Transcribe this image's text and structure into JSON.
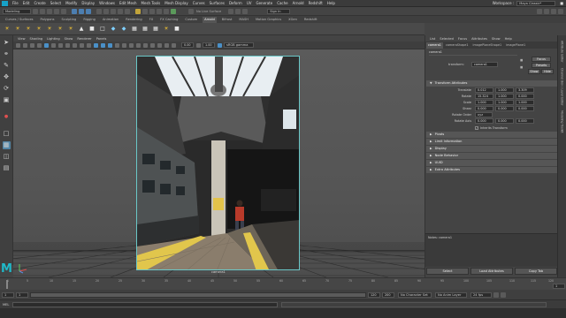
{
  "menubar": {
    "items": [
      "File",
      "Edit",
      "Create",
      "Select",
      "Modify",
      "Display",
      "Windows",
      "Edit Mesh",
      "Mesh Tools",
      "Mesh Display",
      "Curves",
      "Surfaces",
      "Deform",
      "UV",
      "Generate",
      "Cache",
      "Arnold",
      "Redshift",
      "Help"
    ],
    "workspace_label": "Workspace :",
    "workspace_value": "Maya Classic*"
  },
  "statusline": {
    "mode": "Modeling",
    "live_surface": "No Live Surface",
    "sign_in": "Sign In"
  },
  "shelf": {
    "tabs": [
      "Curves / Surfaces",
      "Polygons",
      "Sculpting",
      "Rigging",
      "Animation",
      "Rendering",
      "FX",
      "FX Caching",
      "Custom",
      "Arnold",
      "Bifrost",
      "MASH",
      "Motion Graphics",
      "XGen",
      "Redshift"
    ],
    "active_tab": "Arnold"
  },
  "viewport": {
    "menu": [
      "View",
      "Shading",
      "Lighting",
      "Show",
      "Renderer",
      "Panels"
    ],
    "exposure": "0.00",
    "gamma": "1.00",
    "color_space": "sRGB gamma",
    "camera_label": "camera1"
  },
  "attribute_editor": {
    "menu": [
      "List",
      "Selected",
      "Focus",
      "Attributes",
      "Show",
      "Help"
    ],
    "tabs": [
      "camera1",
      "cameraShape1",
      "imagePlaneShape1",
      "imagePlane1"
    ],
    "node_field": "camera1",
    "transform_label": "transform:",
    "transform_value": "camera1",
    "buttons_right": [
      "Focus",
      "Presets",
      "Show",
      "Hide"
    ],
    "sections": {
      "transform_attributes": "Transform Attributes",
      "collapsed": [
        "Pivots",
        "Limit Information",
        "Display",
        "Node Behavior",
        "UUID",
        "Extra Attributes"
      ]
    },
    "attrs": [
      {
        "label": "Translate",
        "values": [
          "0.012",
          "1.000",
          "3.309"
        ]
      },
      {
        "label": "Rotate",
        "values": [
          "15.324",
          "1.000",
          "0.000"
        ]
      },
      {
        "label": "Scale",
        "values": [
          "1.000",
          "1.000",
          "1.000"
        ]
      },
      {
        "label": "Shear",
        "values": [
          "0.000",
          "0.000",
          "0.000"
        ]
      },
      {
        "label": "Rotate Order",
        "values": [
          "xyz"
        ]
      },
      {
        "label": "Rotate Axis",
        "values": [
          "0.000",
          "0.000",
          "0.000"
        ]
      }
    ],
    "inherits_transform": "Inherits Transform",
    "notes_label": "Notes: camera1",
    "bottom_buttons": [
      "Select",
      "Load Attributes",
      "Copy Tab"
    ]
  },
  "right_tabs": [
    "Attribute Editor",
    "Channel Box / Layer Editor",
    "Modeling Toolkit",
    "Tool Settings"
  ],
  "timeline": {
    "ticks": [
      "1",
      "5",
      "10",
      "15",
      "20",
      "25",
      "30",
      "35",
      "40",
      "45",
      "50",
      "55",
      "60",
      "65",
      "70",
      "75",
      "80",
      "85",
      "90",
      "95",
      "100",
      "105",
      "110",
      "115",
      "120"
    ],
    "current_frame": "1",
    "start": "1",
    "range_start": "1",
    "range_end": "120",
    "end": "200",
    "character_set": "No Character Set",
    "anim_layer": "No Anim Layer",
    "fps": "24 fps"
  },
  "cmdline": {
    "label": "MEL"
  }
}
